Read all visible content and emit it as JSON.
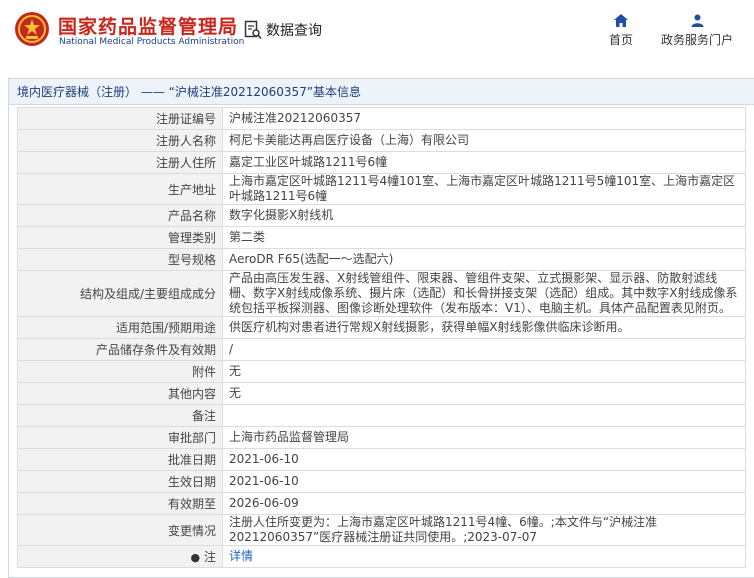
{
  "header": {
    "brand_cn": "国家药品监督管理局",
    "brand_en": "National Medical Products Administration",
    "search_label": "数据查询",
    "nav": {
      "home": "首页",
      "service": "政务服务门户"
    },
    "colors": {
      "brand_red": "#c8261d",
      "brand_blue": "#1a3f8c",
      "nav_blue": "#1f4ea3"
    }
  },
  "panel": {
    "title": "境内医疗器械（注册） —— “沪械注准20212060357”基本信息"
  },
  "rows": [
    {
      "label": "注册证编号",
      "value": "沪械注准20212060357"
    },
    {
      "label": "注册人名称",
      "value": "柯尼卡美能达再启医疗设备（上海）有限公司"
    },
    {
      "label": "注册人住所",
      "value": "嘉定工业区叶城路1211号6幢"
    },
    {
      "label": "生产地址",
      "value": "上海市嘉定区叶城路1211号4幢101室、上海市嘉定区叶城路1211号5幢101室、上海市嘉定区叶城路1211号6幢"
    },
    {
      "label": "产品名称",
      "value": "数字化摄影X射线机"
    },
    {
      "label": "管理类别",
      "value": "第二类"
    },
    {
      "label": "型号规格",
      "value": "AeroDR F65(选配一～选配六)"
    },
    {
      "label": "结构及组成/主要组成成分",
      "value": "产品由高压发生器、X射线管组件、限束器、管组件支架、立式摄影架、显示器、防散射滤线栅、数字X射线成像系统、摄片床（选配）和长骨拼接支架（选配）组成。其中数字X射线成像系统包括平板探测器、图像诊断处理软件（发布版本：V1）、电脑主机。具体产品配置表见附页。"
    },
    {
      "label": "适用范围/预期用途",
      "value": "供医疗机构对患者进行常规X射线摄影，获得单幅X射线影像供临床诊断用。"
    },
    {
      "label": "产品储存条件及有效期",
      "value": "/"
    },
    {
      "label": "附件",
      "value": "无"
    },
    {
      "label": "其他内容",
      "value": "无"
    },
    {
      "label": "备注",
      "value": ""
    },
    {
      "label": "审批部门",
      "value": "上海市药品监督管理局"
    },
    {
      "label": "批准日期",
      "value": "2021-06-10"
    },
    {
      "label": "生效日期",
      "value": "2021-06-10"
    },
    {
      "label": "有效期至",
      "value": "2026-06-09"
    },
    {
      "label": "变更情况",
      "value": "注册人住所变更为：上海市嘉定区叶城路1211号4幢、6幢。;本文件与“沪械注准20212060357”医疗器械注册证共同使用。;2023-07-07"
    },
    {
      "label": "注",
      "value": "详情"
    }
  ]
}
